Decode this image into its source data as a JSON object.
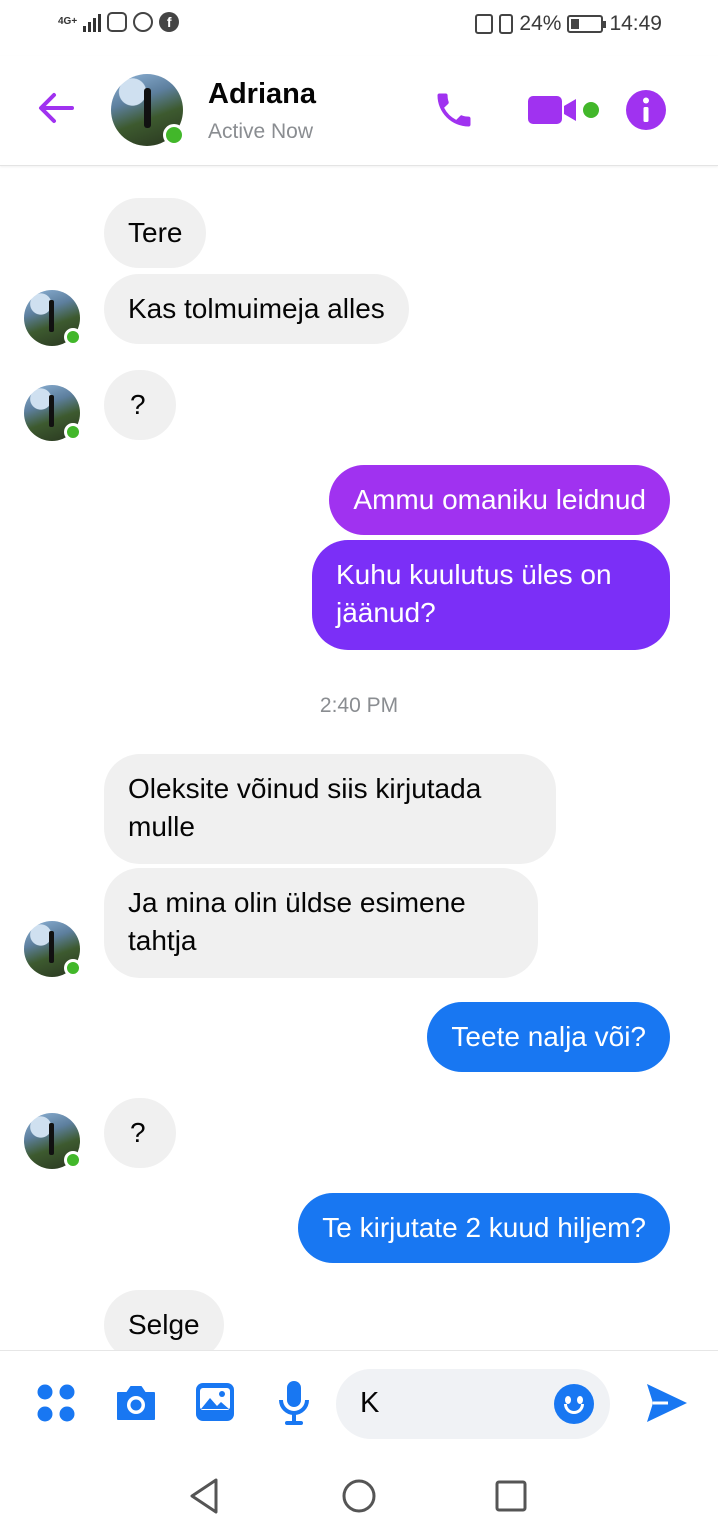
{
  "status_bar": {
    "network": "4G+",
    "battery": "24%",
    "time": "14:49"
  },
  "header": {
    "contact_name": "Adriana",
    "contact_status": "Active Now",
    "accent": "#a032f0"
  },
  "messages": [
    {
      "from": "them",
      "text": "Tere"
    },
    {
      "from": "them",
      "text": "Kas tolmuimeja alles"
    },
    {
      "from": "them",
      "text": "?"
    },
    {
      "from": "me",
      "text": "Ammu omaniku leidnud"
    },
    {
      "from": "me",
      "text_line1": "Kuhu kuulutus üles on",
      "text_line2": "jäänud?"
    },
    {
      "from": "them",
      "text_line1": "Oleksite võinud siis kirjutada",
      "text_line2": "mulle"
    },
    {
      "from": "them",
      "text_line1": "Ja mina olin üldse esimene",
      "text_line2": "tahtja"
    },
    {
      "from": "me",
      "text": "Teete nalja või?"
    },
    {
      "from": "them",
      "text": "?"
    },
    {
      "from": "me",
      "text": "Te kirjutate 2 kuud hiljem?"
    },
    {
      "from": "them",
      "text": "Selge"
    }
  ],
  "timestamp": "2:40 PM",
  "composer": {
    "input_value": "K",
    "icon_color": "#1877f2"
  },
  "icons": [
    "back-arrow-icon",
    "phone-icon",
    "video-camera-icon",
    "info-icon",
    "apps-icon",
    "camera-icon",
    "gallery-icon",
    "microphone-icon",
    "emoji-icon",
    "send-icon",
    "nav-back-icon",
    "nav-home-icon",
    "nav-recents-icon"
  ]
}
